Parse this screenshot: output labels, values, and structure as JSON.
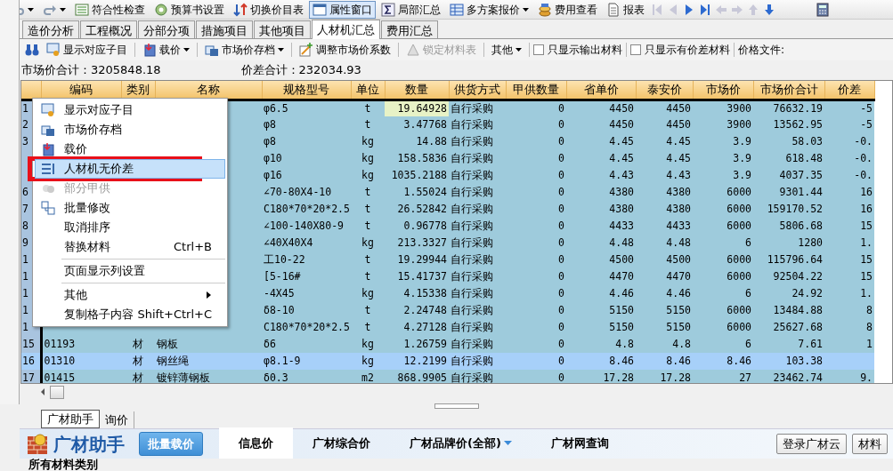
{
  "toolbar": [
    {
      "kind": "undo"
    },
    {
      "kind": "redo"
    },
    {
      "label": "符合性检查",
      "pressed": false,
      "dropdown": false
    },
    {
      "label": "预算书设置",
      "pressed": false,
      "dropdown": false
    },
    {
      "label": "切换价目表",
      "pressed": false,
      "dropdown": false
    },
    {
      "label": "属性窗口",
      "pressed": true,
      "dropdown": false
    },
    {
      "label": "局部汇总",
      "pressed": false,
      "dropdown": false
    },
    {
      "label": "多方案报价",
      "pressed": false,
      "dropdown": true
    },
    {
      "label": "费用查看",
      "pressed": false,
      "dropdown": false
    },
    {
      "label": "报表",
      "pressed": false,
      "dropdown": false
    }
  ],
  "tabs": [
    {
      "label": "造价分析",
      "selected": false
    },
    {
      "label": "工程概况",
      "selected": false
    },
    {
      "label": "分部分项",
      "selected": false
    },
    {
      "label": "措施项目",
      "selected": false
    },
    {
      "label": "其他项目",
      "selected": false
    },
    {
      "label": "人材机汇总",
      "selected": true
    },
    {
      "label": "费用汇总",
      "selected": false
    }
  ],
  "subtoolbar": [
    {
      "kind": "button",
      "label": "显示对应子目",
      "disabled": false,
      "dropdown": false
    },
    {
      "kind": "button",
      "label": "载价",
      "disabled": false,
      "dropdown": true
    },
    {
      "kind": "button",
      "label": "市场价存档",
      "disabled": false,
      "dropdown": true
    },
    {
      "kind": "button",
      "label": "调整市场价系数",
      "disabled": false,
      "dropdown": false
    },
    {
      "kind": "button",
      "label": "锁定材料表",
      "disabled": true,
      "dropdown": false
    },
    {
      "kind": "button",
      "label": "其他",
      "disabled": false,
      "dropdown": true
    },
    {
      "kind": "checkbox",
      "label": "只显示输出材料",
      "checked": false
    },
    {
      "kind": "checkbox",
      "label": "只显示有价差材料",
      "checked": false
    },
    {
      "kind": "label",
      "label": "价格文件:"
    }
  ],
  "summary": [
    "市场价合计：3205848.18",
    "价差合计：232034.93"
  ],
  "table": {
    "columns": [
      "",
      "编码",
      "类别",
      "名称",
      "规格型号",
      "单位",
      "数量",
      "供货方式",
      "甲供数量",
      "省单价",
      "泰安价",
      "市场价",
      "市场价合计",
      "价差"
    ],
    "rows": [
      {
        "selected": false,
        "cells": [
          "1",
          "",
          "",
          "",
          "φ6.5",
          "t",
          "19.64928",
          "自行采购",
          "0",
          "4450",
          "4450",
          "3900",
          "76632.19",
          "-5"
        ],
        "quantity_focused": true
      },
      {
        "selected": false,
        "cells": [
          "2",
          "",
          "",
          "",
          "φ8",
          "t",
          "3.47768",
          "自行采购",
          "0",
          "4450",
          "4450",
          "3900",
          "13562.95",
          "-5"
        ]
      },
      {
        "selected": false,
        "cells": [
          "3",
          "",
          "",
          "",
          "φ8",
          "kg",
          "14.88",
          "自行采购",
          "0",
          "4.45",
          "4.45",
          "3.9",
          "58.03",
          "-0."
        ]
      },
      {
        "selected": false,
        "cells": [
          "",
          "",
          "",
          "",
          "φ10",
          "kg",
          "158.5836",
          "自行采购",
          "0",
          "4.45",
          "4.45",
          "3.9",
          "618.48",
          "-0."
        ]
      },
      {
        "selected": false,
        "cells": [
          "",
          "",
          "",
          "",
          "φ16",
          "kg",
          "1035.2188",
          "自行采购",
          "0",
          "4.43",
          "4.43",
          "3.9",
          "4037.35",
          "-0."
        ]
      },
      {
        "selected": false,
        "cells": [
          "6",
          "",
          "",
          "",
          "∠70-80X4-10",
          "t",
          "1.55024",
          "自行采购",
          "0",
          "4380",
          "4380",
          "6000",
          "9301.44",
          "16"
        ]
      },
      {
        "selected": false,
        "cells": [
          "7",
          "",
          "",
          "",
          "C180*70*20*2.5",
          "t",
          "26.52842",
          "自行采购",
          "0",
          "4380",
          "4380",
          "6000",
          "159170.52",
          "16"
        ]
      },
      {
        "selected": false,
        "cells": [
          "8",
          "",
          "",
          "",
          "∠100-140X80-9",
          "t",
          "0.96778",
          "自行采购",
          "0",
          "4433",
          "4433",
          "6000",
          "5806.68",
          "15"
        ]
      },
      {
        "selected": false,
        "cells": [
          "9",
          "",
          "",
          "",
          "∠40X40X4",
          "kg",
          "213.3327",
          "自行采购",
          "0",
          "4.48",
          "4.48",
          "6",
          "1280",
          "1."
        ]
      },
      {
        "selected": false,
        "cells": [
          "1",
          "",
          "",
          "",
          "工10-22",
          "t",
          "19.29944",
          "自行采购",
          "0",
          "4500",
          "4500",
          "6000",
          "115796.64",
          "15"
        ]
      },
      {
        "selected": false,
        "cells": [
          "1",
          "",
          "",
          "",
          "[5-16#",
          "t",
          "15.41737",
          "自行采购",
          "0",
          "4470",
          "4470",
          "6000",
          "92504.22",
          "15"
        ]
      },
      {
        "selected": false,
        "cells": [
          "1",
          "",
          "",
          "",
          "-4X45",
          "kg",
          "4.15338",
          "自行采购",
          "0",
          "4.46",
          "4.46",
          "6",
          "24.92",
          "1."
        ]
      },
      {
        "selected": false,
        "cells": [
          "1",
          "",
          "",
          "",
          "δ8-10",
          "t",
          "2.24748",
          "自行采购",
          "0",
          "5150",
          "5150",
          "6000",
          "13484.88",
          "8"
        ]
      },
      {
        "selected": false,
        "cells": [
          "1",
          "",
          "",
          "",
          "C180*70*20*2.5",
          "t",
          "4.27128",
          "自行采购",
          "0",
          "5150",
          "5150",
          "6000",
          "25627.68",
          "8"
        ]
      },
      {
        "selected": false,
        "cells": [
          "15",
          "01193",
          "材",
          "钢板",
          "δ6",
          "kg",
          "1.26759",
          "自行采购",
          "0",
          "4.8",
          "4.8",
          "6",
          "7.61",
          "1"
        ]
      },
      {
        "selected": true,
        "cells": [
          "16",
          "01310",
          "材",
          "钢丝绳",
          "φ8.1-9",
          "kg",
          "12.2199",
          "自行采购",
          "0",
          "8.46",
          "8.46",
          "8.46",
          "103.38",
          ""
        ]
      },
      {
        "selected": false,
        "cells": [
          "17",
          "01415",
          "材",
          "镀锌薄钢板",
          "δ0.3",
          "m2",
          "868.9905",
          "自行采购",
          "0",
          "17.28",
          "17.28",
          "27",
          "23462.74",
          "9."
        ]
      }
    ]
  },
  "context_menu": [
    {
      "kind": "item",
      "label": "显示对应子目",
      "has_icon": true,
      "disabled": false,
      "hovered": false,
      "boxed": false
    },
    {
      "kind": "item",
      "label": "市场价存档",
      "has_icon": true,
      "disabled": false,
      "hovered": false,
      "boxed": false
    },
    {
      "kind": "item",
      "label": "载价",
      "has_icon": true,
      "disabled": false,
      "hovered": false,
      "boxed": false
    },
    {
      "kind": "item",
      "label": "人材机无价差",
      "has_icon": true,
      "disabled": false,
      "hovered": true,
      "boxed": true
    },
    {
      "kind": "item",
      "label": "部分甲供",
      "has_icon": true,
      "disabled": true,
      "hovered": false,
      "boxed": false
    },
    {
      "kind": "item",
      "label": "批量修改",
      "has_icon": true,
      "disabled": false,
      "hovered": false,
      "boxed": false
    },
    {
      "kind": "item",
      "label": "取消排序",
      "has_icon": false,
      "disabled": false,
      "hovered": false,
      "boxed": false
    },
    {
      "kind": "item",
      "label": "替换材料",
      "shortcut": "Ctrl+B",
      "has_icon": false,
      "disabled": false,
      "hovered": false,
      "boxed": false
    },
    {
      "kind": "separator"
    },
    {
      "kind": "item",
      "label": "页面显示列设置",
      "has_icon": false,
      "disabled": false,
      "hovered": false,
      "boxed": false
    },
    {
      "kind": "separator"
    },
    {
      "kind": "submenu",
      "label": "其他",
      "has_icon": false,
      "disabled": false,
      "hovered": false,
      "boxed": false
    },
    {
      "kind": "item",
      "label": "复制格子内容",
      "shortcut": "Shift+Ctrl+C",
      "has_icon": false,
      "disabled": false,
      "hovered": false,
      "boxed": false
    }
  ],
  "bottom_tabs": [
    {
      "label": "广材助手",
      "selected": true
    },
    {
      "label": "询价",
      "selected": false
    }
  ],
  "assistant": {
    "title": "广材助手",
    "batch_button": "批量载价",
    "tabs": [
      {
        "label": "信息价",
        "selected": true,
        "dropdown": false
      },
      {
        "label": "广材综合价",
        "selected": false,
        "dropdown": false
      },
      {
        "label": "广材品牌价(全部)",
        "selected": false,
        "dropdown": true
      },
      {
        "label": "广材网查询",
        "selected": false,
        "dropdown": false
      }
    ],
    "buttons": [
      "登录广材云",
      "材料"
    ],
    "category_heading": "所有材料类别"
  }
}
